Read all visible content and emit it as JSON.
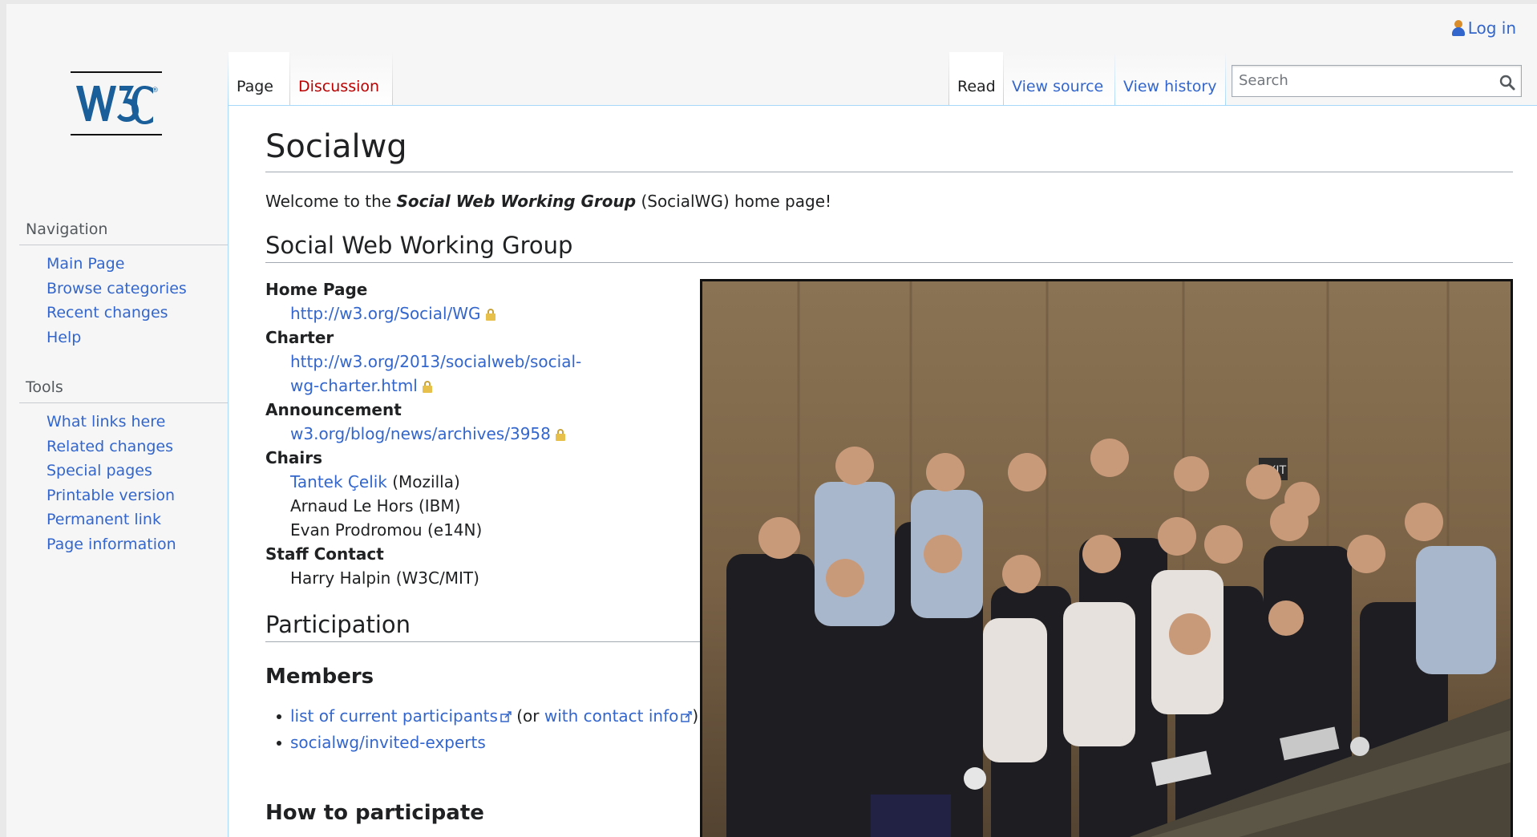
{
  "personal": {
    "login_label": "Log in"
  },
  "logo": {
    "alt": "W3C"
  },
  "sidebar": {
    "navigation": {
      "heading": "Navigation",
      "items": [
        "Main Page",
        "Browse categories",
        "Recent changes",
        "Help"
      ]
    },
    "tools": {
      "heading": "Tools",
      "items": [
        "What links here",
        "Related changes",
        "Special pages",
        "Printable version",
        "Permanent link",
        "Page information"
      ]
    }
  },
  "tabs": {
    "page": "Page",
    "discussion": "Discussion",
    "read": "Read",
    "view_source": "View source",
    "view_history": "View history"
  },
  "search": {
    "placeholder": "Search",
    "value": ""
  },
  "article": {
    "title": "Socialwg",
    "intro_prefix": "Welcome to the ",
    "intro_bold": "Social Web Working Group",
    "intro_suffix": " (SocialWG) home page!",
    "section1": "Social Web Working Group",
    "home_page_label": "Home Page",
    "home_page_link": "http://w3.org/Social/WG",
    "charter_label": "Charter",
    "charter_link_line1": "http://w3.org/2013/socialweb/social-",
    "charter_link_line2": "wg-charter.html",
    "announcement_label": "Announcement",
    "announcement_link": "w3.org/blog/news/archives/3958",
    "chairs_label": "Chairs",
    "chair1_name": "Tantek Çelik",
    "chair1_org": " (Mozilla)",
    "chair2": "Arnaud Le Hors (IBM)",
    "chair3": "Evan Prodromou (e14N)",
    "staff_label": "Staff Contact",
    "staff1": "Harry Halpin (W3C/MIT)",
    "section2": "Participation",
    "members_heading": "Members",
    "members_item1_link": "list of current participants",
    "members_item1_mid": " (or ",
    "members_item1_link2": "with contact info",
    "members_item1_end": ")",
    "members_item2_link": "socialwg/invited-experts",
    "howto_heading": "How to participate"
  },
  "colors": {
    "link": "#3366cc",
    "new_link": "#ba0000",
    "tab_border": "#a7d7f9",
    "sidebar_bg": "#f6f6f6"
  }
}
